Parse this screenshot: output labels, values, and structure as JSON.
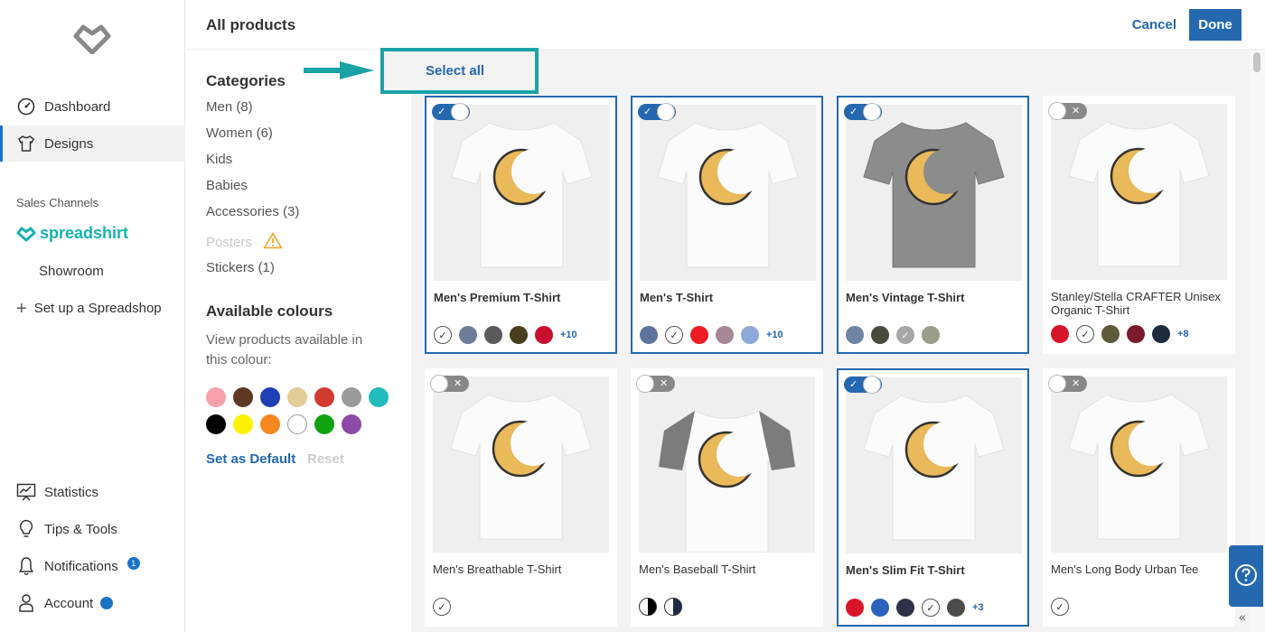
{
  "sidebar": {
    "nav_top": [
      {
        "label": "Dashboard",
        "icon": "dashboard-gauge-icon"
      },
      {
        "label": "Designs",
        "icon": "tshirt-icon",
        "active": true
      }
    ],
    "sales_channels_label": "Sales Channels",
    "brand": "spreadshirt",
    "showroom": "Showroom",
    "setup": "Set up a Spreadshop",
    "nav_bottom": [
      {
        "label": "Statistics",
        "icon": "statistics-icon"
      },
      {
        "label": "Tips & Tools",
        "icon": "lightbulb-icon"
      },
      {
        "label": "Notifications",
        "icon": "bell-icon",
        "badge": "1"
      },
      {
        "label": "Account",
        "icon": "user-icon"
      }
    ]
  },
  "header": {
    "title": "All products",
    "cancel": "Cancel",
    "done": "Done"
  },
  "select_all": "Select all",
  "filters": {
    "categories_title": "Categories",
    "categories": [
      {
        "label": "Men (8)"
      },
      {
        "label": "Women (6)"
      },
      {
        "label": "Kids"
      },
      {
        "label": "Babies"
      },
      {
        "label": "Accessories (3)"
      },
      {
        "label": "Posters",
        "disabled": true,
        "warning": true
      },
      {
        "label": "Stickers (1)"
      }
    ],
    "colours_title": "Available colours",
    "colours_desc": "View products available in this colour:",
    "colour_swatches": [
      "#f7a1ad",
      "#5c3a21",
      "#1f3fb5",
      "#e2cc98",
      "#d23a2f",
      "#9a9a9a",
      "#21bcbc",
      "#000000",
      "#fff200",
      "#f7871f",
      "#ffffff",
      "#0fa30f",
      "#8e4aa8"
    ],
    "set_default": "Set as Default",
    "reset": "Reset"
  },
  "products": [
    {
      "name": "Men's Premium T-Shirt",
      "selected": true,
      "shirt": "white",
      "colors": [
        "white-check",
        "#6e7c9a",
        "#5a5a5a",
        "#4a3e1e",
        "#c8102e"
      ],
      "more": "+10"
    },
    {
      "name": "Men's T-Shirt",
      "selected": true,
      "shirt": "white",
      "colors": [
        "#5c739b",
        "white-check",
        "#ee1c25",
        "#a98695",
        "#8ea8d9"
      ],
      "more": "+10"
    },
    {
      "name": "Men's Vintage T-Shirt",
      "selected": true,
      "shirt": "grey",
      "colors": [
        "#6f83a3",
        "#4a4a3c",
        "grey-check",
        "#9a9d88"
      ],
      "more": ""
    },
    {
      "name": "Stanley/Stella CRAFTER Unisex Organic T-Shirt",
      "selected": false,
      "shirt": "white",
      "colors": [
        "#d7152a",
        "white-check",
        "#5e5a3a",
        "#7a1a2c",
        "#1e2a3e"
      ],
      "more": "+8"
    },
    {
      "name": "Men's Breathable T-Shirt",
      "selected": false,
      "shirt": "white",
      "colors": [
        "white-check"
      ],
      "more": ""
    },
    {
      "name": "Men's Baseball T-Shirt",
      "selected": false,
      "shirt": "raglan",
      "colors": [
        "half-black",
        "half-navy"
      ],
      "more": ""
    },
    {
      "name": "Men's Slim Fit T-Shirt",
      "selected": true,
      "shirt": "white",
      "colors": [
        "#d7152a",
        "#2a62bd",
        "#2b3247",
        "white-check",
        "#4c4c4c"
      ],
      "more": "+3"
    },
    {
      "name": "Men's Long Body Urban Tee",
      "selected": false,
      "shirt": "white",
      "colors": [
        "white-check"
      ],
      "more": ""
    }
  ]
}
